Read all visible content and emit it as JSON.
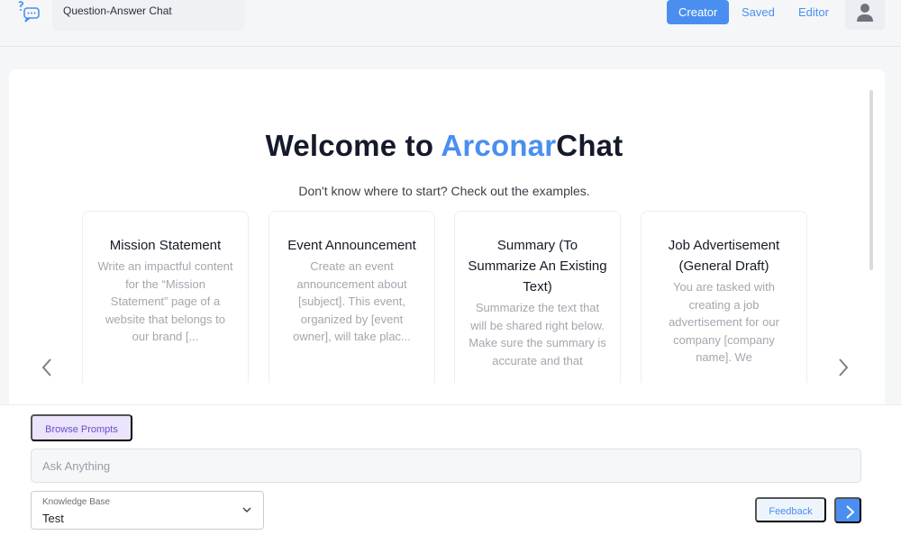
{
  "header": {
    "chat_title": "Question-Answer Chat",
    "nav": {
      "creator": "Creator",
      "saved": "Saved",
      "editor": "Editor"
    }
  },
  "main": {
    "welcome_prefix": "Welcome to ",
    "welcome_accent": "Arconar",
    "welcome_suffix": "Chat",
    "subtitle": "Don't know where to start? Check out the examples.",
    "prev_icon": "chevron-left-icon",
    "next_icon": "chevron-right-icon",
    "cards": [
      {
        "title": "Mission Statement",
        "body": "Write an impactful content for the “Mission Statement” page of a website that belongs to our brand [..."
      },
      {
        "title": "Event Announcement",
        "body": "Create an event announcement about [subject]. This event, organized by [event owner], will take plac..."
      },
      {
        "title": "Summary (To Summarize An Existing Text)",
        "body": "Summarize the text that will be shared right below. Make sure the summary is accurate and that"
      },
      {
        "title": "Job Advertisement (General Draft)",
        "body": "You are tasked with creating a job advertisement for our company [company name]. We"
      }
    ]
  },
  "footer": {
    "browse_prompts": "Browse Prompts",
    "ask_placeholder": "Ask Anything",
    "knowledge_base_label": "Knowledge Base",
    "knowledge_base_value": "Test",
    "feedback": "Feedback"
  },
  "colors": {
    "accent": "#4a8ff0",
    "browse_bg": "#ebe4fb",
    "browse_text": "#6a4fc7"
  }
}
